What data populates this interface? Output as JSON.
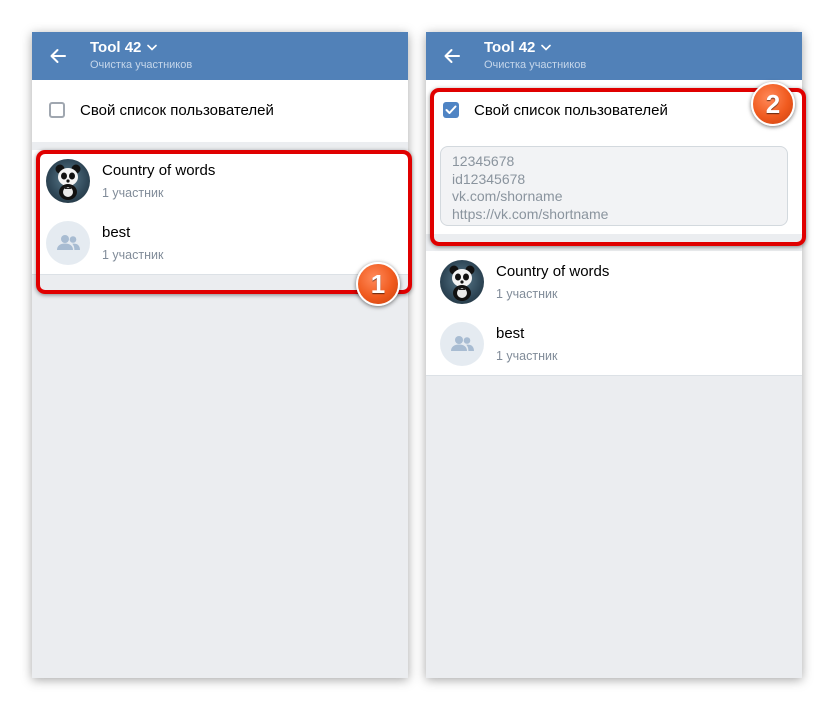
{
  "colors": {
    "header_bg": "#5181b8",
    "background": "#ebedf0",
    "checkbox_checked": "#4f84c4",
    "highlight": "#e00000",
    "badge": "#f05a1e"
  },
  "left_screen": {
    "header": {
      "title": "Tool 42",
      "subtitle": "Очистка участников",
      "back_icon": "arrow-left-icon",
      "title_dropdown_icon": "chevron-down-icon"
    },
    "checkbox": {
      "label": "Свой список пользователей",
      "checked": false
    },
    "items": [
      {
        "title": "Country of words",
        "subtitle": "1 участник",
        "avatar": "panda-photo"
      },
      {
        "title": "best",
        "subtitle": "1 участник",
        "avatar": "group-placeholder-icon"
      }
    ],
    "badge": "1"
  },
  "right_screen": {
    "header": {
      "title": "Tool 42",
      "subtitle": "Очистка участников",
      "back_icon": "arrow-left-icon",
      "title_dropdown_icon": "chevron-down-icon"
    },
    "checkbox": {
      "label": "Свой список пользователей",
      "checked": true
    },
    "textarea": {
      "placeholder_lines": [
        "12345678",
        "id12345678",
        "vk.com/shorname",
        "https://vk.com/shortname"
      ]
    },
    "items": [
      {
        "title": "Country of words",
        "subtitle": "1 участник",
        "avatar": "panda-photo"
      },
      {
        "title": "best",
        "subtitle": "1 участник",
        "avatar": "group-placeholder-icon"
      }
    ],
    "badge": "2"
  }
}
